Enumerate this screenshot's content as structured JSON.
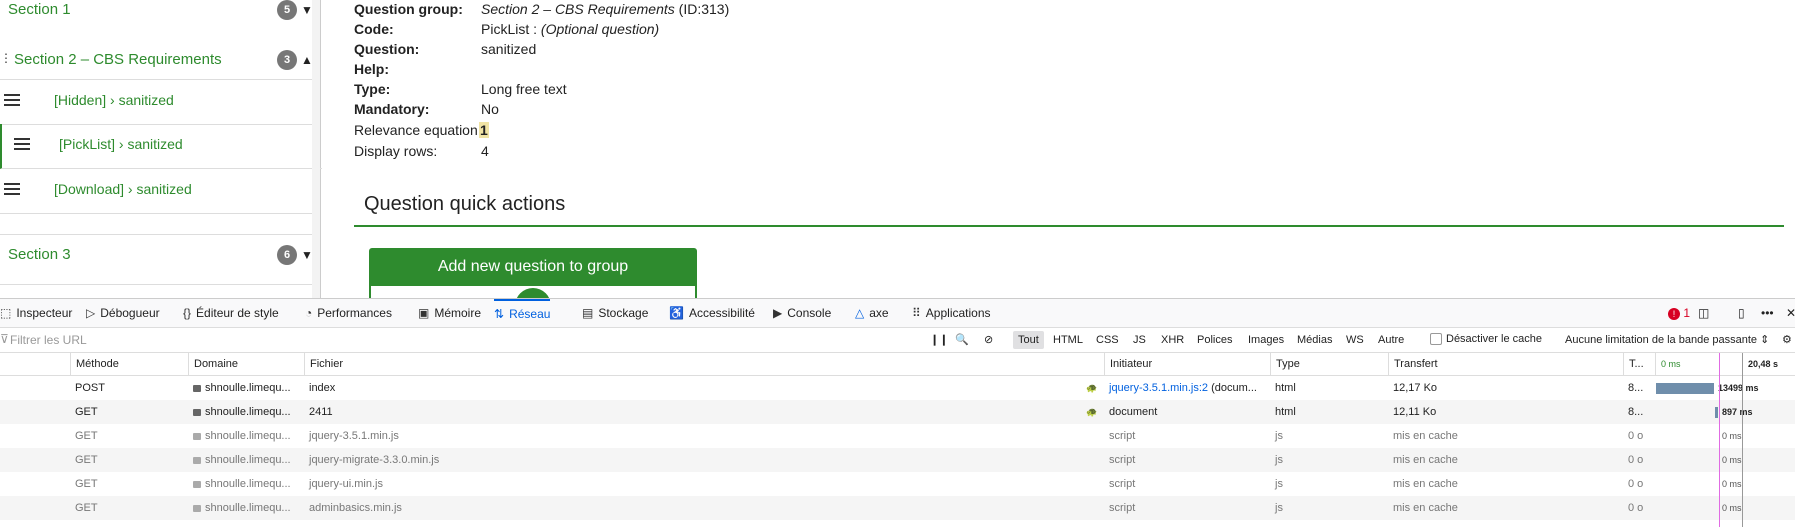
{
  "sidebar": {
    "section1": {
      "label": "Section 1",
      "count": "5"
    },
    "section2": {
      "label": "Section 2 – CBS Requirements",
      "count": "3"
    },
    "questions": [
      {
        "label": "[Hidden] › sanitized"
      },
      {
        "label": "[PickList] › sanitized"
      },
      {
        "label": "[Download] › sanitized"
      }
    ],
    "section3": {
      "label": "Section 3",
      "count": "6"
    }
  },
  "question": {
    "group_label": "Question group:",
    "group_value": "Section 2 – CBS Requirements",
    "group_id": "(ID:313)",
    "code_label": "Code:",
    "code_value": "PickList : ",
    "code_optional": "(Optional question)",
    "question_label": "Question:",
    "question_value": "sanitized",
    "help_label": "Help:",
    "type_label": "Type:",
    "type_value": "Long free text",
    "mandatory_label": "Mandatory:",
    "mandatory_value": "No",
    "relevance_label": "Relevance equation:",
    "relevance_value": "1",
    "rows_label": "Display rows:",
    "rows_value": "4"
  },
  "quick_actions": {
    "title": "Question quick actions",
    "add_button": "Add new question to group"
  },
  "devtools": {
    "tabs": [
      "Inspecteur",
      "Débogueur",
      "Éditeur de style",
      "Performances",
      "Mémoire",
      "Réseau",
      "Stockage",
      "Accessibilité",
      "Console",
      "axe",
      "Applications"
    ],
    "error_count": "1",
    "filter_placeholder": "Filtrer les URL",
    "pause_label": "❙❙",
    "filters": [
      "Tout",
      "HTML",
      "CSS",
      "JS",
      "XHR",
      "Polices",
      "Images",
      "Médias",
      "WS",
      "Autre"
    ],
    "disable_cache": "Désactiver le cache",
    "throttling": "Aucune limitation de la bande passante ⇕",
    "columns": {
      "method": "Méthode",
      "domain": "Domaine",
      "file": "Fichier",
      "initiator": "Initiateur",
      "type": "Type",
      "transfer": "Transfert",
      "size": "T...",
      "wf_start": "0 ms",
      "wf_end": "20,48 s"
    },
    "rows": [
      {
        "method": "POST",
        "domain": "shnoulle.limequ...",
        "file": "index",
        "initiator": "jquery-3.5.1.min.js:2",
        "initiator_extra": "(docum...",
        "type": "html",
        "transfer": "12,17 Ko",
        "size": "8...",
        "timing": "13499 ms",
        "cached": false
      },
      {
        "method": "GET",
        "domain": "shnoulle.limequ...",
        "file": "2411",
        "initiator": "document",
        "initiator_extra": "",
        "type": "html",
        "transfer": "12,11 Ko",
        "size": "8...",
        "timing": "897 ms",
        "cached": false
      },
      {
        "method": "GET",
        "domain": "shnoulle.limequ...",
        "file": "jquery-3.5.1.min.js",
        "initiator": "script",
        "initiator_extra": "",
        "type": "js",
        "transfer": "mis en cache",
        "size": "0 o",
        "timing": "0 ms",
        "cached": true
      },
      {
        "method": "GET",
        "domain": "shnoulle.limequ...",
        "file": "jquery-migrate-3.3.0.min.js",
        "initiator": "script",
        "initiator_extra": "",
        "type": "js",
        "transfer": "mis en cache",
        "size": "0 o",
        "timing": "0 ms",
        "cached": true
      },
      {
        "method": "GET",
        "domain": "shnoulle.limequ...",
        "file": "jquery-ui.min.js",
        "initiator": "script",
        "initiator_extra": "",
        "type": "js",
        "transfer": "mis en cache",
        "size": "0 o",
        "timing": "0 ms",
        "cached": true
      },
      {
        "method": "GET",
        "domain": "shnoulle.limequ...",
        "file": "adminbasics.min.js",
        "initiator": "script",
        "initiator_extra": "",
        "type": "js",
        "transfer": "mis en cache",
        "size": "0 o",
        "timing": "0 ms",
        "cached": true
      }
    ]
  },
  "colors": {
    "accent": "#2e8b2e",
    "devtools_blue": "#0060df",
    "error": "#d70022"
  }
}
